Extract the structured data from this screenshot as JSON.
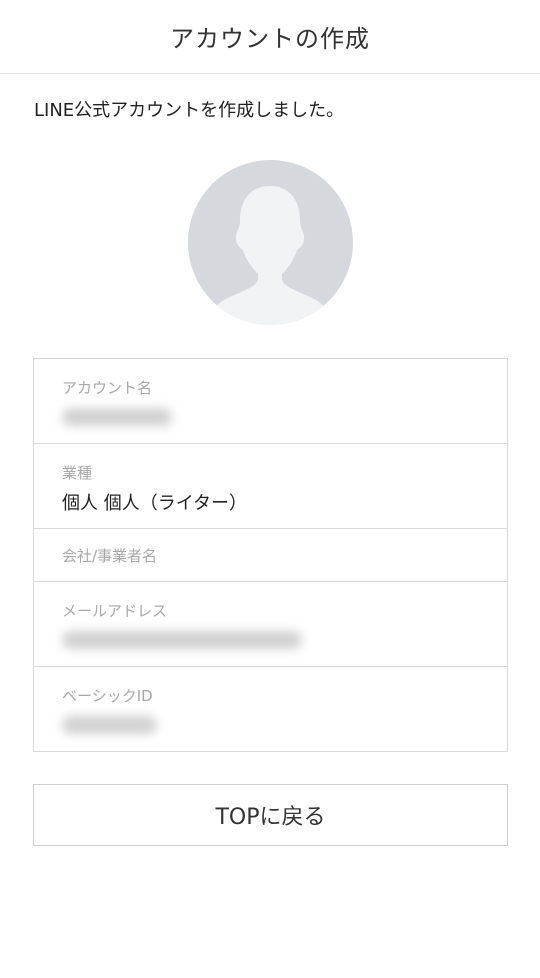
{
  "header": {
    "title": "アカウントの作成"
  },
  "message": "LINE公式アカウントを作成しました。",
  "avatar": {
    "icon": "default-user-avatar-icon",
    "bg_color": "#d5d8dd",
    "fg_color": "#f2f3f5"
  },
  "account_info": {
    "rows": [
      {
        "label": "アカウント名",
        "value": ""
      },
      {
        "label": "業種",
        "value": "個人 個人（ライター）"
      },
      {
        "label": "会社/事業者名",
        "value": ""
      },
      {
        "label": "メールアドレス",
        "value": ""
      },
      {
        "label": "ベーシックID",
        "value": ""
      }
    ]
  },
  "actions": {
    "top_button_label": "TOPに戻る"
  }
}
